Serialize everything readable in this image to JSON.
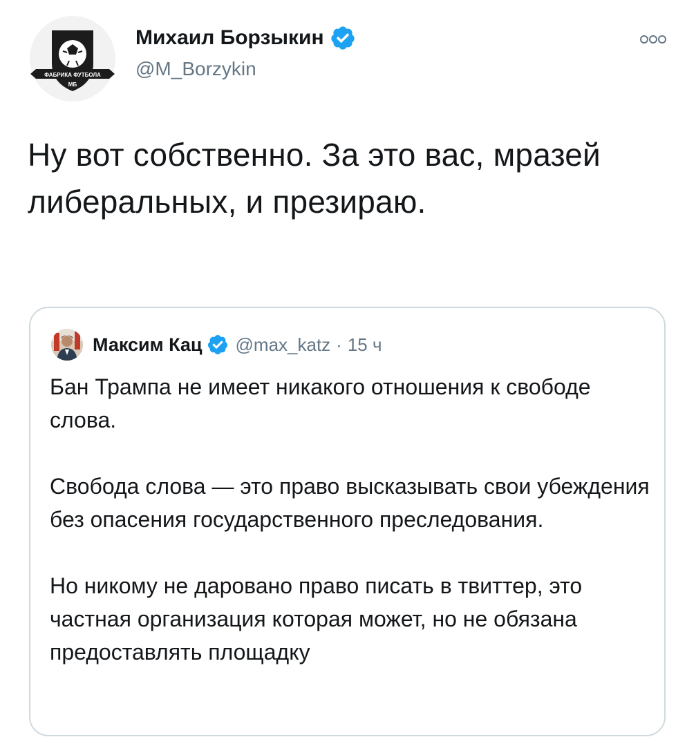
{
  "author": {
    "display_name": "Михаил Борзыкин",
    "handle": "@M_Borzykin",
    "avatar_icon": "football-factory-logo-icon",
    "avatar_text_top": "ФАБРИКА ФУТБОЛА",
    "avatar_text_bottom": "МБ",
    "verified_icon": "verified-badge-icon"
  },
  "more_icon": "more-options-icon",
  "tweet_text": "Ну вот собственно. За это вас, мразей либеральных, и презираю.",
  "quoted": {
    "display_name": "Максим Кац",
    "handle": "@max_katz",
    "separator": "·",
    "time": "15 ч",
    "avatar_icon": "user-avatar-icon",
    "verified_icon": "verified-badge-icon",
    "paragraphs": [
      "Бан Трампа не имеет никакого отношения к свободе слова.",
      "Свобода слова — это право высказывать свои убеждения без опасения государственного преследования.",
      "Но никому не даровано право писать в твиттер, это частная организация которая может, но не обязана предоставлять площадку"
    ]
  },
  "colors": {
    "verified_blue": "#1da1f2",
    "secondary_text": "#657786",
    "primary_text": "#14171a",
    "border": "#cfd9de"
  }
}
